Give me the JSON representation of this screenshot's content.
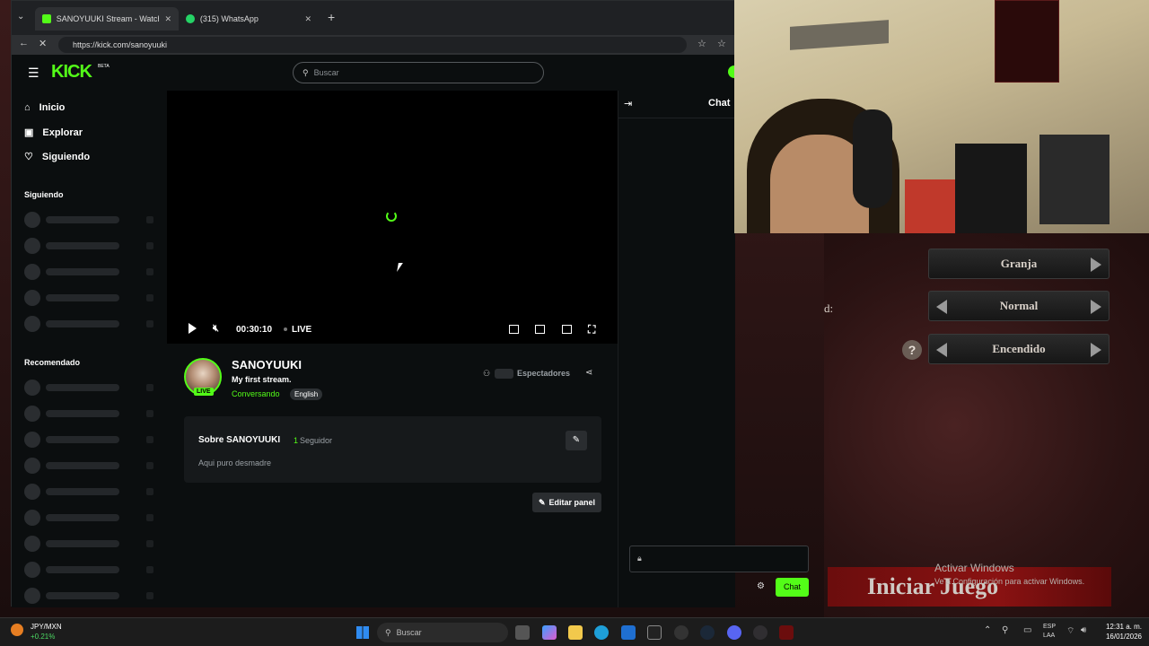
{
  "browser": {
    "tabs": [
      {
        "title": "SANOYUUKI Stream - Watch Live o"
      },
      {
        "title": "(315) WhatsApp"
      }
    ],
    "url": "https://kick.com/sanoyuuki"
  },
  "kick": {
    "logo": "KICK",
    "logo_badge": "BETA",
    "search_placeholder": "Buscar",
    "nav": [
      {
        "label": "Inicio",
        "icon": "home-icon"
      },
      {
        "label": "Explorar",
        "icon": "compass-icon"
      },
      {
        "label": "Siguiendo",
        "icon": "heart-icon"
      }
    ],
    "sections": {
      "following": "Siguiendo",
      "recommended": "Recomendado"
    },
    "player": {
      "time": "00:30:10",
      "live_label": "LIVE"
    },
    "channel": {
      "name": "SANOYUUKI",
      "title": "My first stream.",
      "category": "Conversando",
      "language": "English",
      "live_badge": "LIVE",
      "viewers_label": "Espectadores"
    },
    "about": {
      "heading": "Sobre SANOYUUKI",
      "followers_count": "1",
      "followers_label": "Seguidor",
      "bio": "Aqui puro desmadre"
    },
    "edit_panel_label": "Editar panel",
    "chat": {
      "title": "Chat",
      "send_label": "Chat"
    },
    "accent_color": "#53fc18"
  },
  "game": {
    "options": [
      "Granja",
      "Normal",
      "Encendido"
    ],
    "partial_label": "d:",
    "help_symbol": "?",
    "start_button": "Iniciar Juego"
  },
  "windows": {
    "activate_title": "Activar Windows",
    "activate_sub": "Ve a Configuración para activar Windows."
  },
  "taskbar": {
    "ticker_symbol": "JPY/MXN",
    "ticker_change": "+0.21%",
    "search_placeholder": "Buscar",
    "lang_top": "ESP",
    "lang_bottom": "LAA",
    "time": "12:31 a. m.",
    "date": "16/01/2026"
  }
}
